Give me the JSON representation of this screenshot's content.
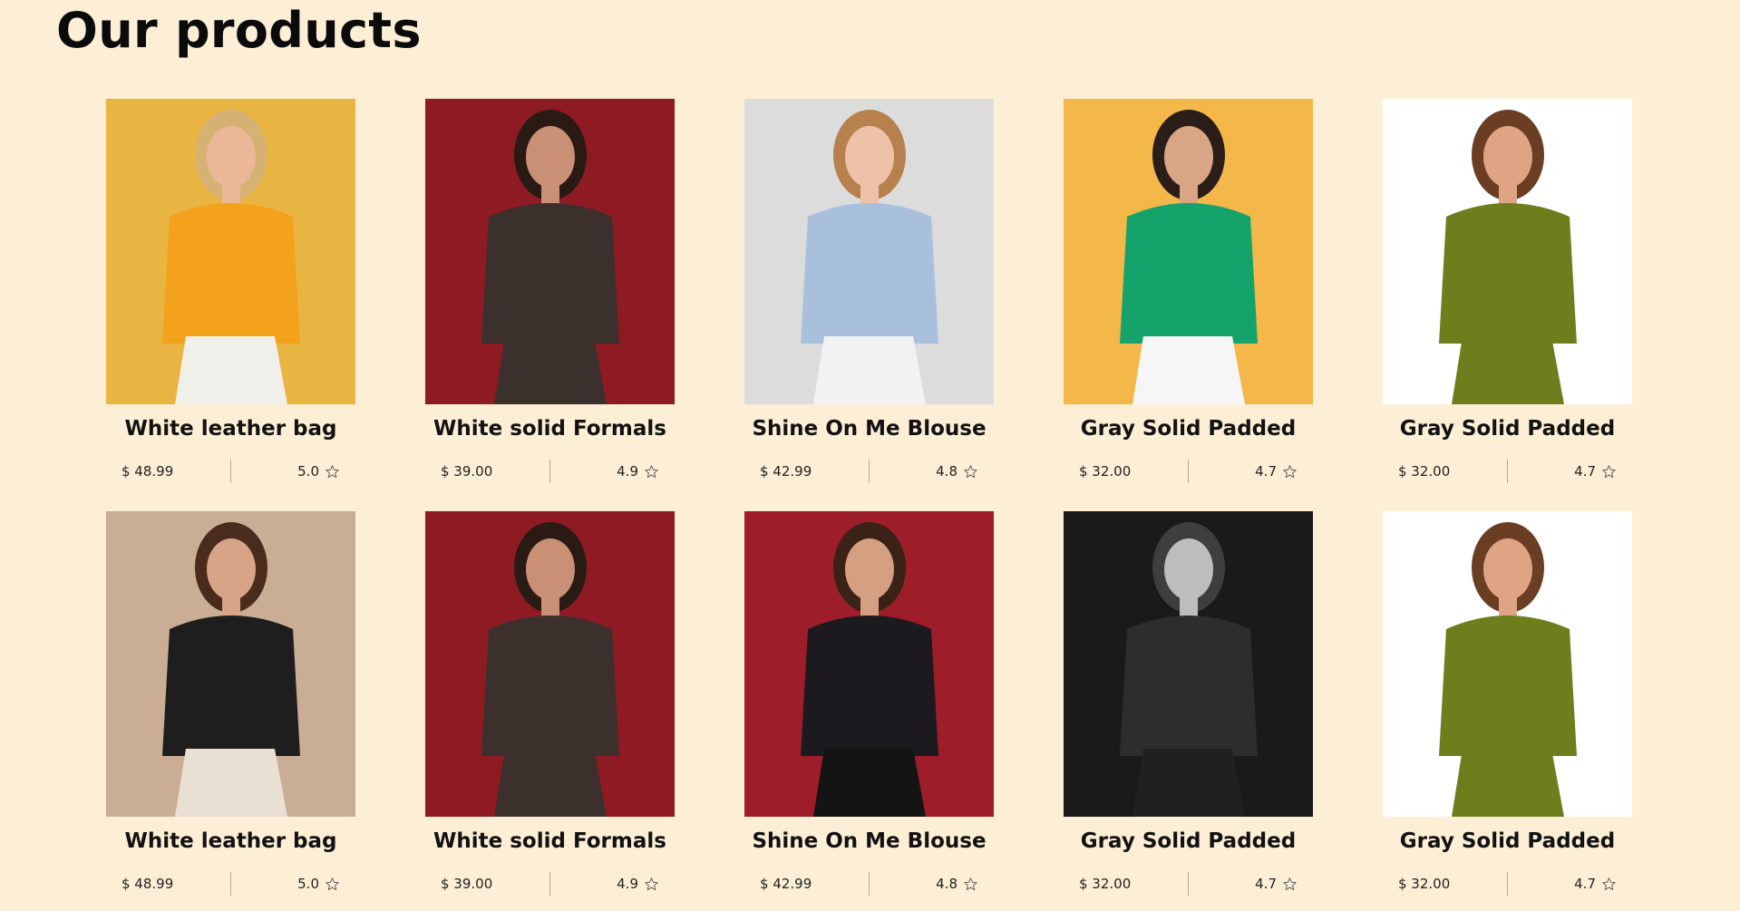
{
  "page": {
    "title": "Our products"
  },
  "products": [
    {
      "name": "White leather bag",
      "price": "$ 48.99",
      "rating": "5.0",
      "bg": "#e9b542",
      "shirt": "#f4a21c",
      "skin": "#eab896",
      "hair": "#d6b174",
      "legs": "#f1efea"
    },
    {
      "name": "White solid Formals",
      "price": "$ 39.00",
      "rating": "4.9",
      "bg": "#8e1b23",
      "shirt": "#3b302c",
      "skin": "#c99075",
      "hair": "#2a1a14",
      "legs": "#3b302c"
    },
    {
      "name": "Shine On Me Blouse",
      "price": "$ 42.99",
      "rating": "4.8",
      "bg": "#dcdcdc",
      "shirt": "#a9c0dc",
      "skin": "#eec2a8",
      "hair": "#b6814d",
      "legs": "#f2f2f2"
    },
    {
      "name": "Gray Solid Padded",
      "price": "$ 32.00",
      "rating": "4.7",
      "bg": "#f3b74a",
      "shirt": "#14a46b",
      "skin": "#d8a585",
      "hair": "#2b1d18",
      "legs": "#f6f6f6"
    },
    {
      "name": "Gray Solid Padded",
      "price": "$ 32.00",
      "rating": "4.7",
      "bg": "#ffffff",
      "shirt": "#6f7e1c",
      "skin": "#dea483",
      "hair": "#6b3d22",
      "legs": "#6f7e1c"
    },
    {
      "name": "White leather bag",
      "price": "$ 48.99",
      "rating": "5.0",
      "bg": "#c9ad95",
      "shirt": "#1e1e1e",
      "skin": "#d7a487",
      "hair": "#4a2c1d",
      "legs": "#e9dfd2"
    },
    {
      "name": "White solid Formals",
      "price": "$ 39.00",
      "rating": "4.9",
      "bg": "#8e1b23",
      "shirt": "#3b302c",
      "skin": "#c99075",
      "hair": "#2a1a14",
      "legs": "#3b302c"
    },
    {
      "name": "Shine On Me Blouse",
      "price": "$ 42.99",
      "rating": "4.8",
      "bg": "#9e1d2b",
      "shirt": "#1c1a1e",
      "skin": "#d59f82",
      "hair": "#3a2216",
      "legs": "#141414"
    },
    {
      "name": "Gray Solid Padded",
      "price": "$ 32.00",
      "rating": "4.7",
      "bg": "#1a1a1a",
      "shirt": "#2d2d2d",
      "skin": "#bdbdbd",
      "hair": "#3e3e3e",
      "legs": "#202020"
    },
    {
      "name": "Gray Solid Padded",
      "price": "$ 32.00",
      "rating": "4.7",
      "bg": "#ffffff",
      "shirt": "#6f7e1c",
      "skin": "#dea483",
      "hair": "#6b3d22",
      "legs": "#6f7e1c"
    }
  ],
  "icons": {
    "rating": "star-outline-icon"
  },
  "colors": {
    "background": "#fcefd5",
    "divider": "#b9ab92"
  }
}
